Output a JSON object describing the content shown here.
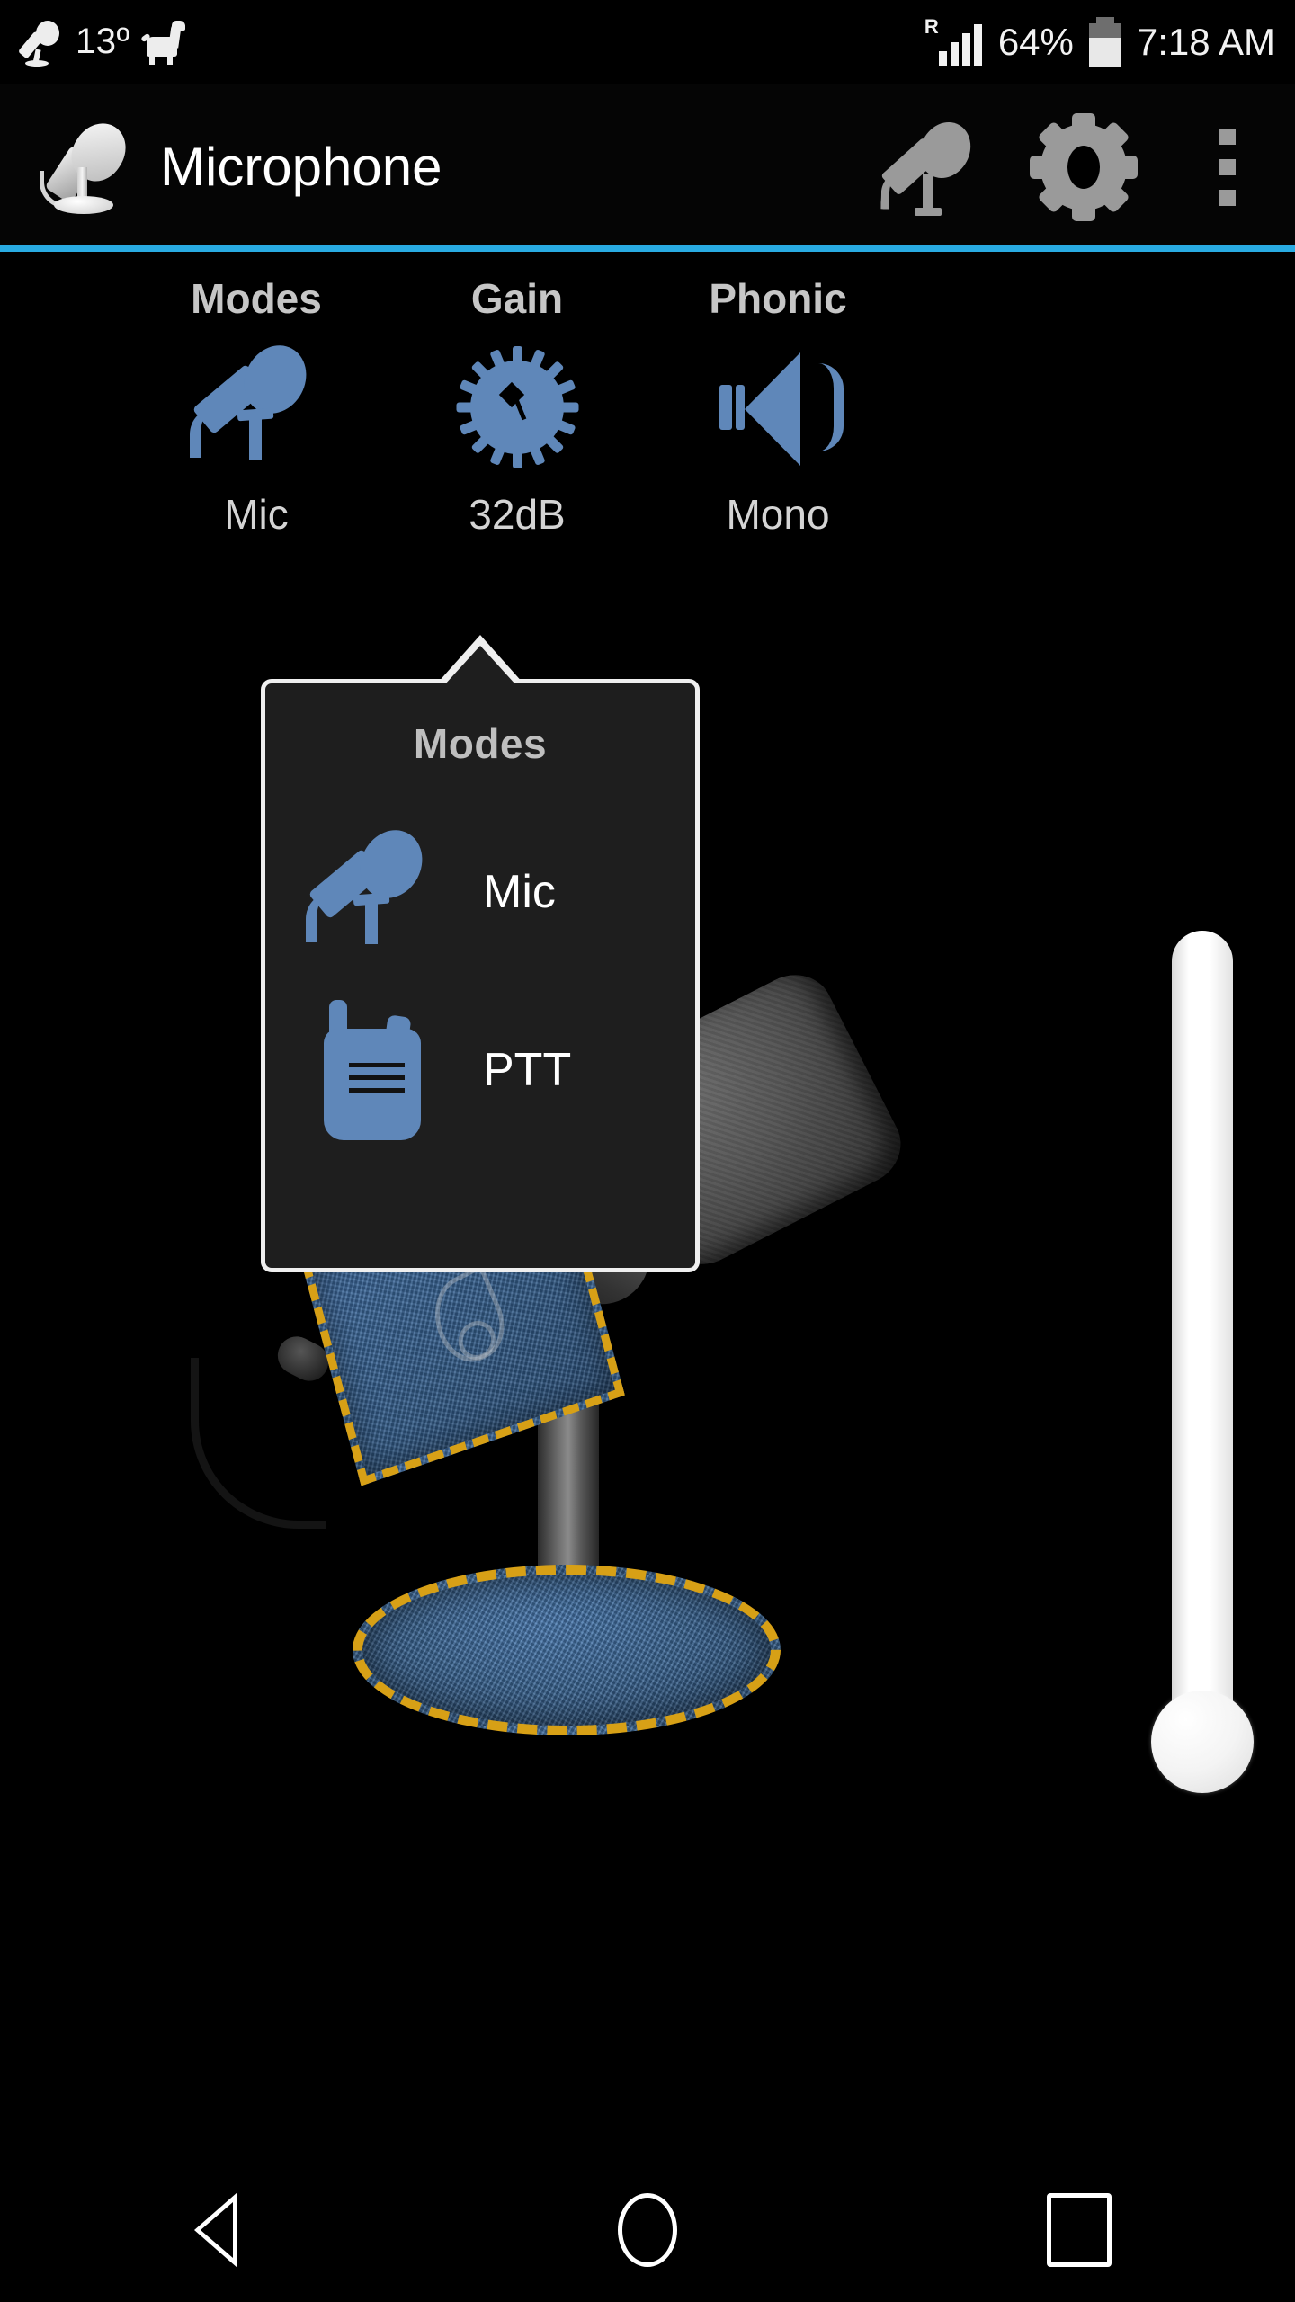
{
  "status_bar": {
    "temperature": "13º",
    "battery_percent": "64%",
    "time": "7:18 AM",
    "network_indicator": "R",
    "icons": [
      "microphone-notification-icon",
      "pet-notification-icon",
      "signal-bars-icon",
      "battery-icon"
    ]
  },
  "action_bar": {
    "title": "Microphone",
    "logo_icon": "microphone-logo-icon",
    "actions": [
      {
        "name": "mic-toggle",
        "icon": "microphone-icon"
      },
      {
        "name": "settings",
        "icon": "gear-icon"
      },
      {
        "name": "overflow",
        "icon": "three-dots-icon"
      }
    ],
    "accent_color": "#29abe2"
  },
  "controls": [
    {
      "title": "Modes",
      "value": "Mic",
      "icon": "microphone-icon"
    },
    {
      "title": "Gain",
      "value": "32dB",
      "icon": "gain-knob-icon"
    },
    {
      "title": "Phonic",
      "value": "Mono",
      "icon": "speaker-icon"
    }
  ],
  "popup": {
    "title": "Modes",
    "items": [
      {
        "label": "Mic",
        "icon": "microphone-icon"
      },
      {
        "label": "PTT",
        "icon": "walkie-talkie-icon"
      }
    ]
  },
  "slider": {
    "name": "gain-slider",
    "orientation": "vertical"
  },
  "artwork": {
    "name": "desk-microphone-illustration"
  },
  "nav_bar": {
    "buttons": [
      {
        "name": "back",
        "icon": "triangle-left-icon"
      },
      {
        "name": "home",
        "icon": "circle-icon"
      },
      {
        "name": "recents",
        "icon": "square-icon"
      }
    ]
  },
  "colors": {
    "accent": "#29abe2",
    "icon_blue": "#5f87b9",
    "icon_gray": "#9a9a9a",
    "popup_bg": "#1e1e1e",
    "popup_border": "#efefef",
    "background": "#000000"
  }
}
